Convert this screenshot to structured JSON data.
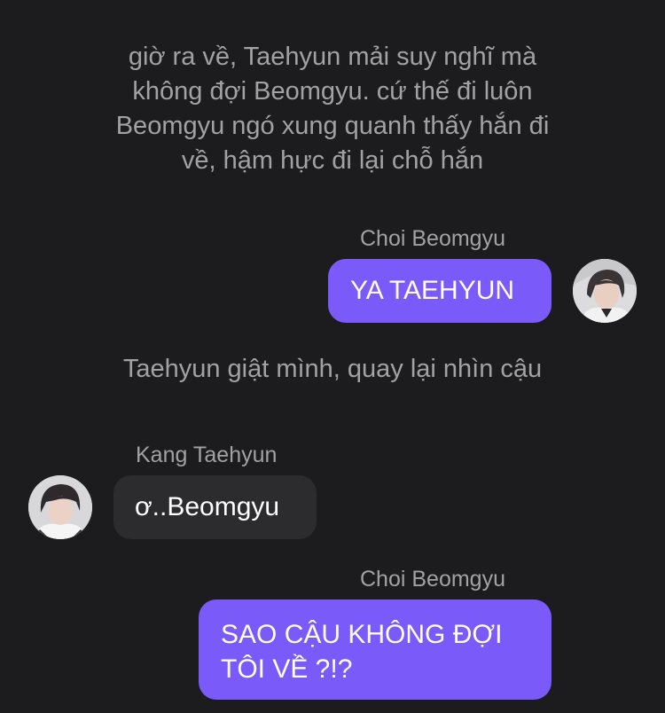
{
  "messages": {
    "narration_1": {
      "lines": [
        "giờ ra về, Taehyun mải suy nghĩ mà",
        "không đợi Beomgyu. cứ thế đi luôn",
        "Beomgyu ngó xung quanh thấy hắn đi",
        "về, hậm hực đi lại chỗ hắn"
      ]
    },
    "msg_1": {
      "sender": "Choi Beomgyu",
      "text": "YA TAEHYUN",
      "avatar_icon": "beomgyu-avatar"
    },
    "narration_2": {
      "text": "Taehyun giật mình, quay lại nhìn cậu"
    },
    "msg_2": {
      "sender": "Kang Taehyun",
      "text": "ơ..Beomgyu",
      "avatar_icon": "taehyun-avatar"
    },
    "msg_3": {
      "sender": "Choi Beomgyu",
      "lines": [
        "SAO CẬU KHÔNG ĐỢI",
        "TÔI VỀ ?!?"
      ]
    }
  },
  "colors": {
    "background": "#1c1c1e",
    "outgoing_bubble": "#7a5af8",
    "incoming_bubble": "#2c2c2e",
    "secondary_text": "#a1a1a6",
    "primary_text": "#ffffff"
  }
}
